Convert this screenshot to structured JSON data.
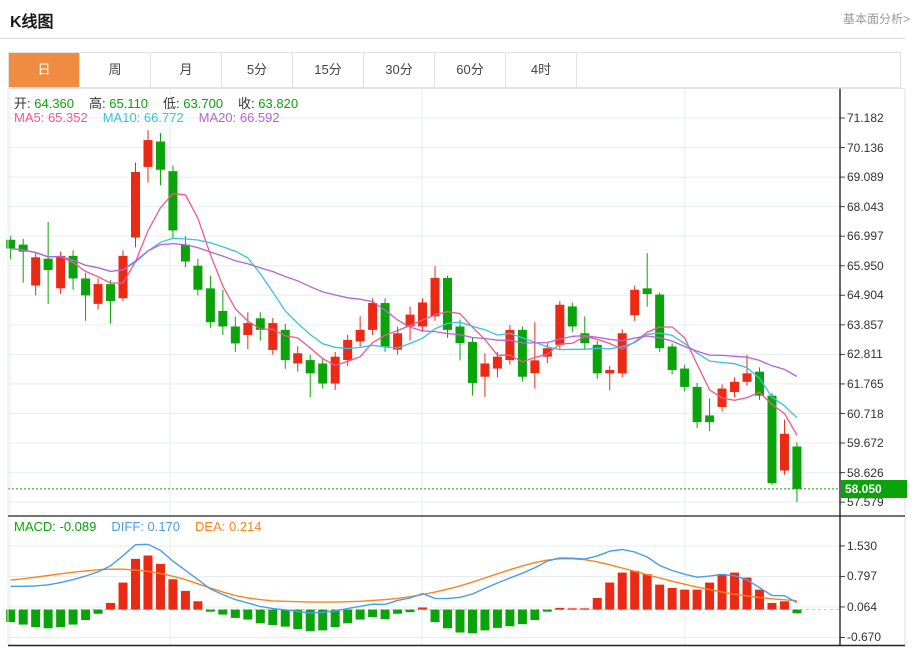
{
  "header": {
    "title": "K线图",
    "link_label": "基本面分析>"
  },
  "tabs": {
    "items": [
      "日",
      "周",
      "月",
      "5分",
      "15分",
      "30分",
      "60分",
      "4时"
    ],
    "selected_index": 0,
    "selected_bg": "#ef8c42"
  },
  "info_rows": {
    "ohlc": [
      {
        "label": "开:",
        "value": "64.360"
      },
      {
        "label": "高:",
        "value": "65.110"
      },
      {
        "label": "低:",
        "value": "63.700"
      },
      {
        "label": "收:",
        "value": "63.820"
      }
    ],
    "ohlc_value_color": "#0aa30a",
    "ma": [
      {
        "label": "MA5:",
        "value": "65.352",
        "color": "#f2588c"
      },
      {
        "label": "MA10:",
        "value": "66.772",
        "color": "#38c2e0"
      },
      {
        "label": "MA20:",
        "value": "66.592",
        "color": "#b763d6"
      }
    ],
    "macd": [
      {
        "label": "MACD:",
        "value": "-0.089",
        "color": "#0aa30a"
      },
      {
        "label": "DIFF:",
        "value": "0.170",
        "color": "#4a9ce8"
      },
      {
        "label": "DEA:",
        "value": "0.214",
        "color": "#f6851f"
      }
    ]
  },
  "chart_data": {
    "type": "candlestick_with_macd",
    "title": "K线图",
    "legend_position": "top-left-overlay",
    "grid": true,
    "colors": {
      "up": "#ea2a14",
      "down": "#0aa30a",
      "ma5": "#f2588c",
      "ma10": "#38c2e0",
      "ma20": "#b763d6",
      "diff": "#4a9ce8",
      "dea": "#f6851f",
      "grid": "#e7edf2",
      "axis_line": "#222222",
      "badge_bg": "#0aa30a",
      "zero_line": "#a9cfe8",
      "current_price_line": "#0aa30a"
    },
    "price_axis": {
      "ticks": [
        71.182,
        70.136,
        69.089,
        68.043,
        66.997,
        65.95,
        64.904,
        63.857,
        62.811,
        61.765,
        60.718,
        59.672,
        58.626,
        57.579
      ],
      "ylim": [
        57.579,
        71.182
      ],
      "last_price": 58.05,
      "last_price_label": "58.050"
    },
    "macd_axis": {
      "ticks": [
        1.53,
        0.797,
        0.064,
        -0.67
      ]
    },
    "ma_periods": [
      5,
      10,
      20
    ],
    "candles_ohlc_format": [
      "open",
      "high",
      "low",
      "close"
    ],
    "candles": [
      [
        66.87,
        67.01,
        66.18,
        66.56
      ],
      [
        66.7,
        66.9,
        65.35,
        66.45
      ],
      [
        65.25,
        66.4,
        64.9,
        66.25
      ],
      [
        66.2,
        67.5,
        64.6,
        65.8
      ],
      [
        65.15,
        66.45,
        64.95,
        66.3
      ],
      [
        66.3,
        66.5,
        65.1,
        65.5
      ],
      [
        65.5,
        65.7,
        64.0,
        64.9
      ],
      [
        64.6,
        65.5,
        64.4,
        65.3
      ],
      [
        65.3,
        65.45,
        63.9,
        64.7
      ],
      [
        64.8,
        66.5,
        64.7,
        66.3
      ],
      [
        66.95,
        69.6,
        66.6,
        69.27
      ],
      [
        69.45,
        70.75,
        68.9,
        70.4
      ],
      [
        70.35,
        70.65,
        68.8,
        69.35
      ],
      [
        69.3,
        69.5,
        66.9,
        67.2
      ],
      [
        66.7,
        67.0,
        65.9,
        66.1
      ],
      [
        65.95,
        66.2,
        64.9,
        65.1
      ],
      [
        65.15,
        65.6,
        63.75,
        63.95
      ],
      [
        64.35,
        65.1,
        63.5,
        63.8
      ],
      [
        63.8,
        64.15,
        62.9,
        63.2
      ],
      [
        63.5,
        64.3,
        63.0,
        63.92
      ],
      [
        64.09,
        64.3,
        63.3,
        63.68
      ],
      [
        62.97,
        64.1,
        62.8,
        63.92
      ],
      [
        63.68,
        63.9,
        62.3,
        62.61
      ],
      [
        62.49,
        63.1,
        62.2,
        62.85
      ],
      [
        62.61,
        62.8,
        61.3,
        62.14
      ],
      [
        62.49,
        62.7,
        61.6,
        61.78
      ],
      [
        61.78,
        62.9,
        61.55,
        62.73
      ],
      [
        62.61,
        63.5,
        62.4,
        63.32
      ],
      [
        63.27,
        64.16,
        63.1,
        63.68
      ],
      [
        63.68,
        64.8,
        63.5,
        64.63
      ],
      [
        64.63,
        64.8,
        62.9,
        63.09
      ],
      [
        62.98,
        63.8,
        62.8,
        63.56
      ],
      [
        63.8,
        64.5,
        63.3,
        64.22
      ],
      [
        63.8,
        64.8,
        63.6,
        64.65
      ],
      [
        64.16,
        65.94,
        64.0,
        65.52
      ],
      [
        65.52,
        65.6,
        63.4,
        63.68
      ],
      [
        63.8,
        64.04,
        62.6,
        63.21
      ],
      [
        63.25,
        63.4,
        61.35,
        61.8
      ],
      [
        62.02,
        62.85,
        61.3,
        62.49
      ],
      [
        62.31,
        62.9,
        62.0,
        62.73
      ],
      [
        62.61,
        63.85,
        62.45,
        63.68
      ],
      [
        63.68,
        63.8,
        61.85,
        62.02
      ],
      [
        62.15,
        63.95,
        61.6,
        62.6
      ],
      [
        62.73,
        63.2,
        62.5,
        63.03
      ],
      [
        63.15,
        64.7,
        63.0,
        64.57
      ],
      [
        64.51,
        64.65,
        63.6,
        63.8
      ],
      [
        63.56,
        64.16,
        63.0,
        63.21
      ],
      [
        63.15,
        63.3,
        61.95,
        62.14
      ],
      [
        62.14,
        62.4,
        61.54,
        62.26
      ],
      [
        62.14,
        63.7,
        62.0,
        63.56
      ],
      [
        64.2,
        65.25,
        64.0,
        65.1
      ],
      [
        65.15,
        66.4,
        64.5,
        64.95
      ],
      [
        64.93,
        65.0,
        62.9,
        63.03
      ],
      [
        63.09,
        63.2,
        62.1,
        62.26
      ],
      [
        62.31,
        62.45,
        61.5,
        61.66
      ],
      [
        61.66,
        61.8,
        60.2,
        60.41
      ],
      [
        60.65,
        61.25,
        60.1,
        60.41
      ],
      [
        60.95,
        61.75,
        60.8,
        61.6
      ],
      [
        61.48,
        62.0,
        61.3,
        61.84
      ],
      [
        61.84,
        62.8,
        61.7,
        62.14
      ],
      [
        62.2,
        62.35,
        61.2,
        61.35
      ],
      [
        61.35,
        61.45,
        58.2,
        58.25
      ],
      [
        58.7,
        60.5,
        58.55,
        60.0
      ],
      [
        59.55,
        59.7,
        57.58,
        58.05
      ]
    ],
    "macd": {
      "hist": [
        -0.3,
        -0.36,
        -0.42,
        -0.45,
        -0.42,
        -0.36,
        -0.25,
        -0.1,
        0.16,
        0.65,
        1.22,
        1.3,
        1.1,
        0.73,
        0.45,
        0.2,
        -0.05,
        -0.12,
        -0.2,
        -0.24,
        -0.33,
        -0.37,
        -0.41,
        -0.47,
        -0.52,
        -0.5,
        -0.42,
        -0.33,
        -0.24,
        -0.18,
        -0.23,
        -0.1,
        -0.06,
        0.05,
        -0.3,
        -0.45,
        -0.55,
        -0.57,
        -0.5,
        -0.44,
        -0.4,
        -0.35,
        -0.25,
        -0.05,
        0.04,
        0.03,
        0.03,
        0.28,
        0.65,
        0.89,
        0.93,
        0.85,
        0.6,
        0.52,
        0.48,
        0.48,
        0.65,
        0.85,
        0.89,
        0.77,
        0.48,
        0.16,
        0.2,
        -0.089
      ],
      "dea": [
        0.71,
        0.74,
        0.78,
        0.82,
        0.86,
        0.9,
        0.93,
        0.96,
        0.97,
        0.97,
        0.95,
        0.92,
        0.87,
        0.8,
        0.72,
        0.62,
        0.52,
        0.42,
        0.34,
        0.28,
        0.24,
        0.21,
        0.2,
        0.19,
        0.18,
        0.18,
        0.18,
        0.19,
        0.2,
        0.22,
        0.24,
        0.27,
        0.31,
        0.36,
        0.42,
        0.49,
        0.57,
        0.66,
        0.76,
        0.86,
        0.96,
        1.05,
        1.13,
        1.19,
        1.22,
        1.22,
        1.2,
        1.15,
        1.08,
        1.0,
        0.92,
        0.84,
        0.76,
        0.68,
        0.61,
        0.54,
        0.48,
        0.42,
        0.37,
        0.33,
        0.29,
        0.26,
        0.235,
        0.214
      ]
    }
  }
}
